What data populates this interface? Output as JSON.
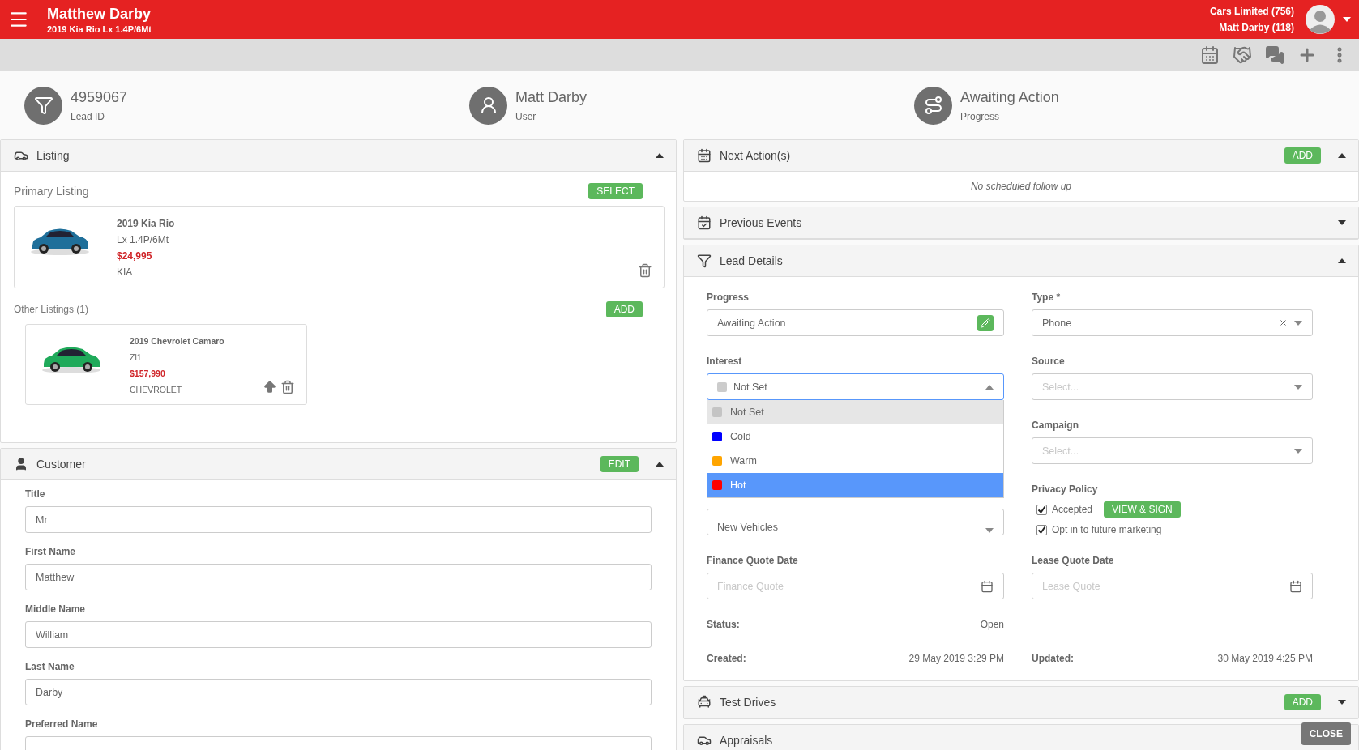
{
  "header": {
    "title": "Matthew Darby",
    "subtitle": "2019 Kia Rio Lx 1.4P/6Mt",
    "account": [
      "Cars Limited (756)",
      "Matt Darby (118)"
    ]
  },
  "summary": [
    {
      "kind": "lead",
      "value": "4959067",
      "label": "Lead ID"
    },
    {
      "kind": "user",
      "value": "Matt Darby",
      "label": "User"
    },
    {
      "kind": "progress",
      "value": "Awaiting Action",
      "label": "Progress"
    }
  ],
  "listing": {
    "title": "Listing",
    "expanded": true,
    "primary_heading": "Primary Listing",
    "select_button": "SELECT",
    "primary": {
      "title": "2019 Kia Rio",
      "trim": "Lx 1.4P/6Mt",
      "price": "$24,995",
      "make": "KIA"
    },
    "other_heading": "Other Listings (1)",
    "add_button": "ADD",
    "others": [
      {
        "title": "2019 Chevrolet Camaro",
        "trim": "Zl1",
        "price": "$157,990",
        "make": "CHEVROLET"
      }
    ]
  },
  "customer": {
    "title": "Customer",
    "expanded": true,
    "edit_button": "EDIT",
    "fields": [
      {
        "label": "Title",
        "value": "Mr"
      },
      {
        "label": "First Name",
        "value": "Matthew"
      },
      {
        "label": "Middle Name",
        "value": "William"
      },
      {
        "label": "Last Name",
        "value": "Darby"
      },
      {
        "label": "Preferred Name"
      }
    ]
  },
  "right_panels": [
    {
      "kind": "next",
      "title": "Next Action(s)",
      "expanded": true,
      "button": "ADD",
      "empty_text": "No scheduled follow up"
    },
    {
      "kind": "previous",
      "title": "Previous Events",
      "expanded": false
    },
    {
      "kind": "lead",
      "title": "Lead Details",
      "expanded": true
    },
    {
      "kind": "test",
      "title": "Test Drives",
      "expanded": false,
      "button": "ADD"
    },
    {
      "kind": "appraisal",
      "title": "Appraisals"
    }
  ],
  "lead_details": {
    "progress": {
      "label": "Progress",
      "value": "Awaiting Action"
    },
    "interest": {
      "label": "Interest",
      "value": "Not Set",
      "color": "#cccccc",
      "open": true,
      "options": [
        {
          "label": "Not Set",
          "color": "#c4c4c4",
          "selected": true,
          "highlighted": false
        },
        {
          "label": "Cold",
          "color": "#0000ff",
          "selected": false,
          "highlighted": false
        },
        {
          "label": "Warm",
          "color": "#ffa500",
          "selected": false,
          "highlighted": false
        },
        {
          "label": "Hot",
          "color": "#ff0000",
          "selected": false,
          "highlighted": true
        }
      ]
    },
    "covered_field": {
      "value": "New Vehicles"
    },
    "type": {
      "label": "Type *",
      "value": "Phone"
    },
    "source": {
      "label": "Source",
      "placeholder": "Select..."
    },
    "campaign": {
      "label": "Campaign",
      "placeholder": "Select..."
    },
    "privacy": {
      "label": "Privacy Policy",
      "checks": [
        {
          "label": "Accepted",
          "checked": true,
          "button": "VIEW & SIGN"
        },
        {
          "label": "Opt in to future marketing",
          "checked": true
        }
      ]
    },
    "finance_date": {
      "label": "Finance Quote Date",
      "placeholder": "Finance Quote"
    },
    "lease_date": {
      "label": "Lease Quote Date",
      "placeholder": "Lease Quote"
    },
    "status": {
      "label": "Status:",
      "value": "Open"
    },
    "created": {
      "label": "Created:",
      "value": "29 May 2019 3:29 PM"
    },
    "updated": {
      "label": "Updated:",
      "value": "30 May 2019 4:25 PM"
    }
  },
  "close_button": "CLOSE"
}
